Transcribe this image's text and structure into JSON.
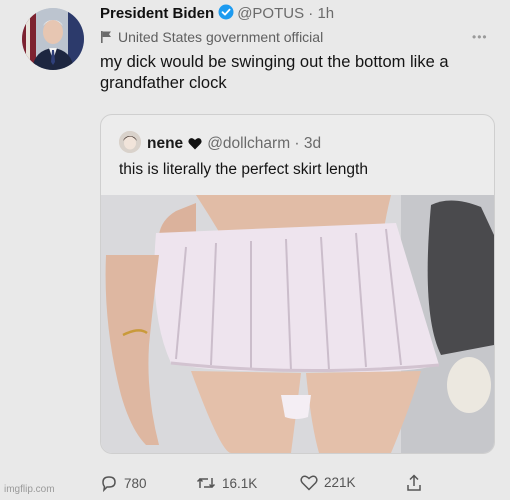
{
  "tweet": {
    "author_name": "President Biden",
    "handle": "@POTUS",
    "separator": " · ",
    "time": "1h",
    "label": "United States government official",
    "text": "my dick would be swinging out the bottom like a grandfather clock"
  },
  "quote": {
    "author_name": "nene",
    "handle": "@dollcharm",
    "separator": " · ",
    "time": "3d",
    "text": "this is literally the perfect skirt length"
  },
  "actions": {
    "replies": "780",
    "retweets": "16.1K",
    "likes": "221K"
  },
  "watermark": "imgflip.com",
  "colors": {
    "verified": "#1d9bf0",
    "background": "#e9e9e9",
    "muted_text": "#6b6b6b"
  },
  "icons": [
    "verified-badge-icon",
    "flag-icon",
    "heart-icon",
    "reply-icon",
    "retweet-icon",
    "like-icon",
    "share-icon",
    "more-icon"
  ]
}
